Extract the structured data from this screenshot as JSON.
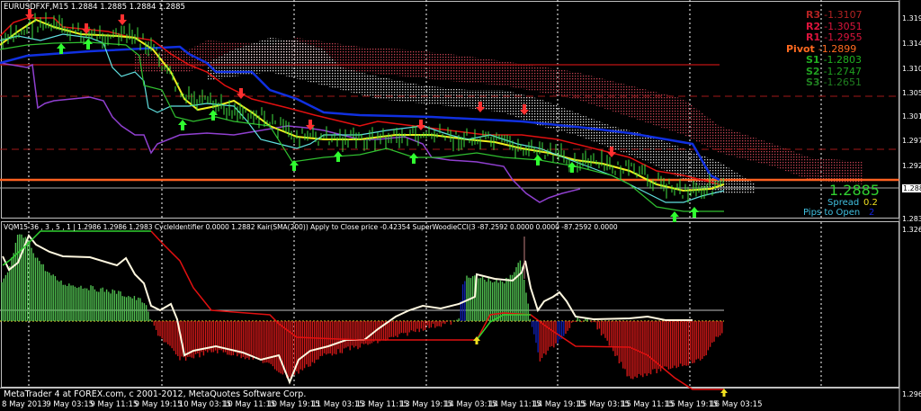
{
  "main": {
    "title": "EURUSDFXF,M15  1.2884 1.2885 1.2884 1.2885",
    "pivots": [
      {
        "label": "R3",
        "value": "-1.3107",
        "color": "#b22222"
      },
      {
        "label": "R2",
        "value": "-1.3051",
        "color": "#dc143c"
      },
      {
        "label": "R1",
        "value": "-1.2955",
        "color": "#dc143c"
      },
      {
        "label": "Pivot",
        "value": "-1.2899",
        "color": "#ff6a20"
      },
      {
        "label": "S1",
        "value": "-1.2803",
        "color": "#20b020"
      },
      {
        "label": "S2",
        "value": "-1.2747",
        "color": "#20a020"
      },
      {
        "label": "S3",
        "value": "-1.2651",
        "color": "#208020"
      }
    ],
    "bid": "1.2885",
    "spread_label": "Spread",
    "spread_value": "0.2",
    "pips_label": "Pips to Open",
    "pips_value": "2",
    "price_axis": [
      "1.3190",
      "1.3145",
      "1.3100",
      "1.3055",
      "1.3015",
      "1.2970",
      "1.2925",
      "1.2885",
      "1.2835"
    ]
  },
  "sub": {
    "indicator_text": "VQM15  36 , 3 , 5 , 1  |  1.2986 1.2986 1.2983  CycleIdentifier 0.0000 1.2882  Kair(SMA(200)) Apply to Close price -0.42354  SuperWoodieCCI(3 -87.2592 0.0000 0.0000 -87.2592 0.0000",
    "axis_top": "1.3265",
    "axis_bottom": "1.2969"
  },
  "footer": {
    "copyright": "MetaTrader 4 at FOREX.com, c 2001-2012, MetaQuotes Software Corp.",
    "time_labels": [
      "8 May 2013",
      "9 May 03:15",
      "9 May 11:15",
      "9 May 19:15",
      "10 May 03:15",
      "10 May 11:15",
      "10 May 19:15",
      "11 May 03:15",
      "13 May 11:15",
      "13 May 19:15",
      "14 May 03:15",
      "14 May 11:15",
      "14 May 19:15",
      "15 May 03:15",
      "15 May 11:15",
      "15 May 19:15",
      "16 May 03:15"
    ]
  }
}
